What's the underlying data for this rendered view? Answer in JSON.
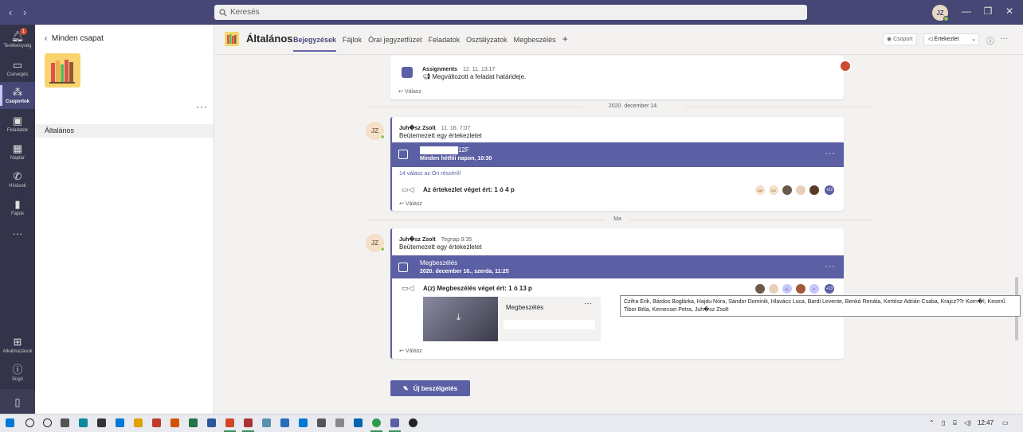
{
  "titlebar": {
    "search_placeholder": "Keresés",
    "user_initials": "JZ"
  },
  "rail": {
    "items": [
      {
        "label": "Tevékenység",
        "icon": "bell-icon",
        "badge": "1"
      },
      {
        "label": "Csevegés",
        "icon": "chat-icon"
      },
      {
        "label": "Csoportok",
        "icon": "teams-icon",
        "active": true
      },
      {
        "label": "Feladatok",
        "icon": "assignments-icon"
      },
      {
        "label": "Naptár",
        "icon": "calendar-icon"
      },
      {
        "label": "Hívások",
        "icon": "phone-icon"
      },
      {
        "label": "Fájlok",
        "icon": "file-icon"
      }
    ],
    "apps_label": "Alkalmazások",
    "help_label": "Súgó"
  },
  "team_pane": {
    "back_label": "Minden csapat",
    "channel": "Általános"
  },
  "channel_header": {
    "name": "Általános",
    "tabs": [
      "Bejegyzések",
      "Fájlok",
      "Órai jegyzetfüzet",
      "Feladatok",
      "Osztályzatok",
      "Megbeszélés"
    ],
    "team_button": "Csoport",
    "meet_button": "Értekezlet"
  },
  "feed": {
    "assignment_post": {
      "sender": "Assignments",
      "time": "12. 11. 13:17",
      "message": "Megváltozott a feladat határideje."
    },
    "reply_label": "Válasz",
    "date1": "2020. december 14.",
    "post1": {
      "initials": "JZ",
      "sender": "Juh�sz Zsolt",
      "time": "11. 16. 7:07",
      "message": "Beütemezett egy értekezletet",
      "meeting_title_suffix": "12F",
      "meeting_schedule": "Minden hétfői napon, 10:30",
      "replies": "14 válasz az Ön részéről",
      "ended": "Az értekezlet véget ért: 1 ó 4 p",
      "participants": [
        "BM",
        "BG"
      ],
      "more_count": "+22"
    },
    "date2": "Ma",
    "post2": {
      "initials": "JZ",
      "sender": "Juh�sz Zsolt",
      "time": "Tegnap 9:35",
      "message": "Beütemezett egy értekezletet",
      "meeting_title": "Megbeszélés",
      "meeting_schedule": "2020. december 16., szerda, 11:25",
      "ended": "A(z) Megbeszélés véget ért: 1 ó 13 p",
      "participants": [
        "KL",
        "P"
      ],
      "more_count": "+13",
      "recording_title": "Megbeszélés"
    },
    "tooltip": "Czifra Erik, Bárdos Boglárka, Hajdu Nóra, Sándor Dominik, Hlavács Luca, Bardi Levente, Benkó Renáta, Kertész Adrián Csaba, Krajcz??r Korn�l, Keserű Tibor Béla, Kemecsei Petra, Juh�sz Zsolt",
    "new_conversation": "Új beszélgetés"
  },
  "taskbar": {
    "time": "12:47"
  },
  "colors": {
    "titlebar": "#464775",
    "rail": "#33344a",
    "accent": "#5b5fa3"
  }
}
